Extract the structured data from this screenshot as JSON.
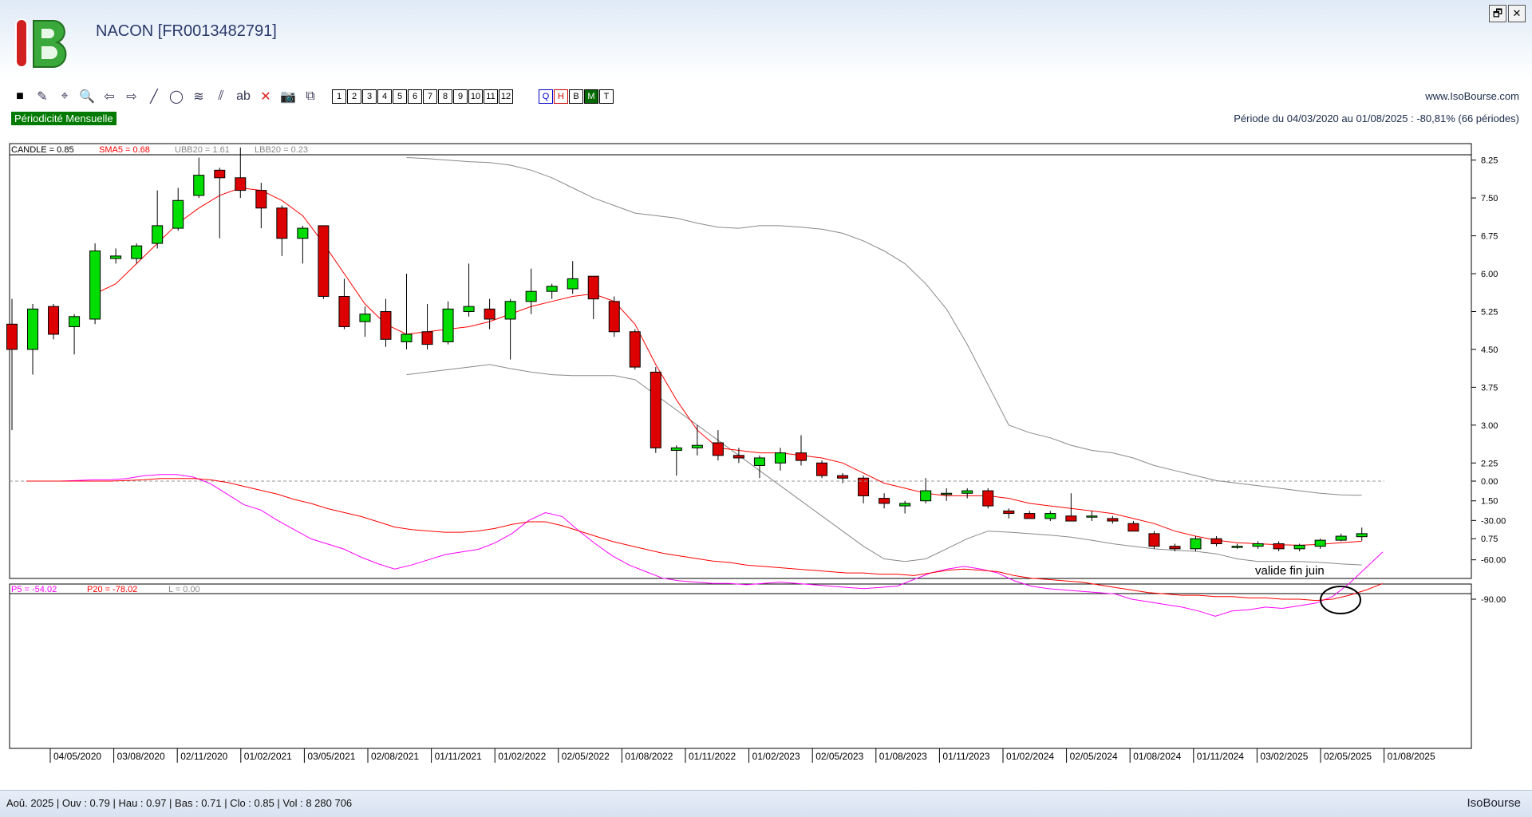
{
  "app": {
    "title": "NACON [FR0013482791]",
    "website": "www.IsoBourse.com",
    "periodicity": "Périodicité Mensuelle",
    "period": "Période du 04/03/2020 au 01/08/2025 : -80,81% (66 périodes)",
    "brand": "IsoBourse"
  },
  "window_buttons": [
    "🗗",
    "✕"
  ],
  "toolbar": {
    "tools": [
      {
        "name": "color-square-icon",
        "glyph": "■"
      },
      {
        "name": "draw-tool-icon",
        "glyph": "✎"
      },
      {
        "name": "crosshair-icon",
        "glyph": "⌖"
      },
      {
        "name": "zoom-icon",
        "glyph": "🔍"
      },
      {
        "name": "arrow-left-icon",
        "glyph": "⇦"
      },
      {
        "name": "arrow-right-icon",
        "glyph": "⇨"
      },
      {
        "name": "line-tool-icon",
        "glyph": "╱"
      },
      {
        "name": "circle-tool-icon",
        "glyph": "◯"
      },
      {
        "name": "fibonacci-icon",
        "glyph": "≋"
      },
      {
        "name": "channel-icon",
        "glyph": "⫽"
      },
      {
        "name": "text-tool-icon",
        "glyph": "ab"
      },
      {
        "name": "delete-icon",
        "glyph": "✕"
      },
      {
        "name": "camera-icon",
        "glyph": "📷"
      },
      {
        "name": "hierarchy-icon",
        "glyph": "⧉"
      }
    ],
    "numbers": [
      "1",
      "2",
      "3",
      "4",
      "5",
      "6",
      "7",
      "8",
      "9",
      "10",
      "11",
      "12"
    ],
    "periods": [
      "Q",
      "H",
      "B",
      "M",
      "T"
    ]
  },
  "colors": {
    "up_candle": "#00dd00",
    "down_candle": "#dd0000",
    "sma": "#ff0000",
    "bands": "#888888",
    "p5": "#ff00ff",
    "p20": "#ff0000"
  },
  "chart_data": [
    {
      "type": "candlestick",
      "legend": [
        {
          "text": "CANDLE = 0.85",
          "color": "#000000"
        },
        {
          "text": "SMA5 = 0.68",
          "color": "#ff0000"
        },
        {
          "text": "UBB20 = 1.61",
          "color": "#888888"
        },
        {
          "text": "LBB20 = 0.23",
          "color": "#888888"
        }
      ],
      "ylim": [
        0.2,
        8.45
      ],
      "yticks": [
        8.25,
        7.5,
        6.75,
        6.0,
        5.25,
        4.5,
        3.75,
        3.0,
        2.25,
        1.5,
        0.75
      ],
      "ytick_labels": [
        "8.25",
        "7.50",
        "6.75",
        "6.00",
        "5.25",
        "4.50",
        "3.75",
        "3.00",
        "2.25",
        "1.50",
        "0.75"
      ],
      "candles": [
        [
          5.0,
          5.5,
          2.9,
          4.5
        ],
        [
          4.5,
          5.4,
          4.0,
          5.3
        ],
        [
          5.35,
          5.4,
          4.7,
          4.8
        ],
        [
          4.95,
          5.2,
          4.4,
          5.15
        ],
        [
          5.1,
          6.6,
          5.0,
          6.45
        ],
        [
          6.3,
          6.5,
          6.2,
          6.35
        ],
        [
          6.3,
          6.6,
          6.2,
          6.55
        ],
        [
          6.6,
          7.65,
          6.5,
          6.95
        ],
        [
          6.9,
          7.7,
          6.85,
          7.45
        ],
        [
          7.55,
          8.3,
          7.5,
          7.95
        ],
        [
          8.05,
          8.1,
          6.7,
          7.9
        ],
        [
          7.9,
          8.5,
          7.5,
          7.65
        ],
        [
          7.65,
          7.8,
          6.9,
          7.3
        ],
        [
          7.3,
          7.35,
          6.35,
          6.7
        ],
        [
          6.7,
          6.95,
          6.2,
          6.9
        ],
        [
          6.95,
          6.95,
          5.5,
          5.55
        ],
        [
          5.55,
          5.9,
          4.9,
          4.95
        ],
        [
          5.05,
          5.35,
          4.75,
          5.2
        ],
        [
          5.25,
          5.5,
          4.55,
          4.7
        ],
        [
          4.65,
          6.0,
          4.5,
          4.8
        ],
        [
          4.85,
          5.4,
          4.5,
          4.6
        ],
        [
          4.65,
          5.45,
          4.6,
          5.3
        ],
        [
          5.25,
          6.2,
          5.15,
          5.35
        ],
        [
          5.3,
          5.5,
          4.9,
          5.1
        ],
        [
          5.1,
          5.5,
          4.3,
          5.45
        ],
        [
          5.45,
          6.1,
          5.2,
          5.65
        ],
        [
          5.65,
          5.8,
          5.5,
          5.75
        ],
        [
          5.7,
          6.25,
          5.6,
          5.9
        ],
        [
          5.95,
          5.95,
          5.1,
          5.5
        ],
        [
          5.45,
          5.55,
          4.75,
          4.85
        ],
        [
          4.85,
          4.9,
          4.1,
          4.15
        ],
        [
          4.05,
          4.15,
          2.45,
          2.55
        ],
        [
          2.5,
          2.6,
          2.0,
          2.55
        ],
        [
          2.55,
          3.0,
          2.4,
          2.6
        ],
        [
          2.65,
          2.9,
          2.3,
          2.4
        ],
        [
          2.4,
          2.55,
          2.25,
          2.35
        ],
        [
          2.2,
          2.4,
          1.95,
          2.35
        ],
        [
          2.25,
          2.55,
          2.1,
          2.45
        ],
        [
          2.45,
          2.8,
          2.2,
          2.3
        ],
        [
          2.25,
          2.3,
          1.95,
          2.0
        ],
        [
          2.0,
          2.05,
          1.85,
          1.95
        ],
        [
          1.95,
          2.0,
          1.45,
          1.6
        ],
        [
          1.55,
          1.65,
          1.35,
          1.45
        ],
        [
          1.4,
          1.5,
          1.25,
          1.45
        ],
        [
          1.5,
          1.95,
          1.45,
          1.7
        ],
        [
          1.65,
          1.75,
          1.5,
          1.65
        ],
        [
          1.65,
          1.75,
          1.55,
          1.7
        ],
        [
          1.7,
          1.75,
          1.35,
          1.4
        ],
        [
          1.3,
          1.35,
          1.15,
          1.25
        ],
        [
          1.25,
          1.3,
          1.15,
          1.15
        ],
        [
          1.15,
          1.3,
          1.1,
          1.25
        ],
        [
          1.2,
          1.65,
          1.15,
          1.1
        ],
        [
          1.2,
          1.3,
          1.1,
          1.2
        ],
        [
          1.15,
          1.2,
          1.05,
          1.1
        ],
        [
          1.05,
          1.1,
          0.9,
          0.9
        ],
        [
          0.85,
          0.9,
          0.55,
          0.6
        ],
        [
          0.6,
          0.65,
          0.5,
          0.55
        ],
        [
          0.55,
          0.8,
          0.5,
          0.75
        ],
        [
          0.75,
          0.8,
          0.6,
          0.65
        ],
        [
          0.6,
          0.65,
          0.55,
          0.6
        ],
        [
          0.6,
          0.7,
          0.55,
          0.65
        ],
        [
          0.65,
          0.7,
          0.5,
          0.55
        ],
        [
          0.55,
          0.65,
          0.5,
          0.62
        ],
        [
          0.6,
          0.75,
          0.55,
          0.72
        ],
        [
          0.72,
          0.85,
          0.7,
          0.8
        ],
        [
          0.79,
          0.97,
          0.71,
          0.85
        ]
      ],
      "sma5": [
        null,
        null,
        null,
        null,
        5.6,
        5.8,
        6.2,
        6.6,
        7.0,
        7.3,
        7.55,
        7.7,
        7.65,
        7.45,
        7.15,
        6.6,
        6.0,
        5.4,
        5.0,
        4.8,
        4.85,
        4.9,
        4.95,
        5.05,
        5.2,
        5.35,
        5.45,
        5.55,
        5.6,
        5.45,
        5.0,
        4.2,
        3.5,
        2.9,
        2.55,
        2.5,
        2.45,
        2.45,
        2.4,
        2.35,
        2.25,
        2.05,
        1.85,
        1.75,
        1.65,
        1.6,
        1.6,
        1.6,
        1.55,
        1.45,
        1.4,
        1.35,
        1.3,
        1.25,
        1.15,
        1.05,
        0.9,
        0.8,
        0.72,
        0.67,
        0.65,
        0.63,
        0.62,
        0.64,
        0.67,
        0.7
      ],
      "ubb20": [
        null,
        null,
        null,
        null,
        null,
        null,
        null,
        null,
        null,
        null,
        null,
        null,
        null,
        null,
        null,
        null,
        null,
        null,
        null,
        8.3,
        8.28,
        8.25,
        8.22,
        8.2,
        8.15,
        8.05,
        7.9,
        7.7,
        7.5,
        7.35,
        7.2,
        7.15,
        7.1,
        7.0,
        6.92,
        6.9,
        6.95,
        6.95,
        6.92,
        6.88,
        6.8,
        6.65,
        6.45,
        6.2,
        5.8,
        5.3,
        4.6,
        3.8,
        3.0,
        2.85,
        2.75,
        2.6,
        2.5,
        2.45,
        2.35,
        2.2,
        2.1,
        2.0,
        1.9,
        1.85,
        1.8,
        1.75,
        1.7,
        1.65,
        1.62,
        1.61
      ],
      "lbb20": [
        null,
        null,
        null,
        null,
        null,
        null,
        null,
        null,
        null,
        null,
        null,
        null,
        null,
        null,
        null,
        null,
        null,
        null,
        null,
        4.0,
        4.05,
        4.1,
        4.15,
        4.2,
        4.12,
        4.05,
        4.0,
        3.98,
        3.98,
        3.98,
        3.9,
        3.6,
        3.3,
        3.0,
        2.7,
        2.4,
        2.1,
        1.8,
        1.5,
        1.2,
        0.9,
        0.6,
        0.35,
        0.3,
        0.35,
        0.55,
        0.75,
        0.9,
        0.88,
        0.85,
        0.82,
        0.78,
        0.72,
        0.65,
        0.6,
        0.55,
        0.52,
        0.5,
        0.45,
        0.35,
        0.3,
        0.3,
        0.3,
        0.28,
        0.25,
        0.23
      ]
    },
    {
      "type": "line",
      "legend": [
        {
          "text": "P5 = -54.02",
          "color": "#ff00ff"
        },
        {
          "text": "P20 = -78.02",
          "color": "#ff0000"
        },
        {
          "text": "L = 0.00",
          "color": "#888888"
        }
      ],
      "ylim": [
        -105,
        6
      ],
      "yticks": [
        0,
        -30,
        -60,
        -90
      ],
      "ytick_labels": [
        "0.00",
        "-30.00",
        "-60.00",
        "-90.00"
      ],
      "zero_line": 0,
      "series": [
        {
          "name": "P5",
          "values": [
            null,
            0,
            0,
            0,
            0.5,
            1,
            1,
            2,
            4,
            5,
            5,
            3,
            -2,
            -10,
            -18,
            -22,
            -30,
            -37,
            -44,
            -48,
            -52,
            -58,
            -63,
            -67,
            -64,
            -60,
            -56,
            -54,
            -52,
            -47,
            -40,
            -30,
            -24,
            -27,
            -38,
            -48,
            -57,
            -64,
            -69,
            -74,
            -76,
            -77,
            -78,
            -78,
            -79,
            -78,
            -77,
            -78,
            -79,
            -80,
            -81,
            -82,
            -81,
            -80,
            -75,
            -70,
            -67,
            -65,
            -67,
            -70,
            -76,
            -80,
            -82,
            -83,
            -84,
            -85,
            -86,
            -90,
            -92,
            -94,
            -96,
            -99,
            -103,
            -99,
            -98,
            -96,
            -97,
            -95,
            -93,
            -88,
            -78,
            -66,
            -54
          ]
        },
        {
          "name": "P20",
          "values": [
            null,
            0,
            0,
            0,
            0,
            0,
            0,
            0.5,
            1,
            2,
            2,
            2,
            1,
            -1,
            -4,
            -7,
            -10,
            -14,
            -17,
            -21,
            -24,
            -27,
            -31,
            -35,
            -37,
            -38,
            -39,
            -39,
            -38,
            -36,
            -33,
            -31,
            -31,
            -34,
            -38,
            -42,
            -46,
            -49,
            -52,
            -55,
            -57,
            -59,
            -61,
            -62,
            -64,
            -65,
            -66,
            -67,
            -68,
            -69,
            -70,
            -70,
            -71,
            -71,
            -72,
            -70,
            -68,
            -67,
            -68,
            -69,
            -72,
            -74,
            -75,
            -76,
            -77,
            -79,
            -81,
            -83,
            -85,
            -86,
            -87,
            -87,
            -88,
            -88,
            -89,
            -89,
            -90,
            -90,
            -91,
            -90,
            -87,
            -83,
            -78
          ]
        }
      ],
      "annotation": "valide fin juin"
    }
  ],
  "x_axis": {
    "labels": [
      "04/05/2020",
      "03/08/2020",
      "02/11/2020",
      "01/02/2021",
      "03/05/2021",
      "02/08/2021",
      "01/11/2021",
      "01/02/2022",
      "02/05/2022",
      "01/08/2022",
      "01/11/2022",
      "01/02/2023",
      "02/05/2023",
      "01/08/2023",
      "01/11/2023",
      "01/02/2024",
      "02/05/2024",
      "01/08/2024",
      "01/11/2024",
      "03/02/2025",
      "02/05/2025",
      "01/08/2025"
    ]
  },
  "statusbar": {
    "info": "Aoû. 2025 | Ouv : 0.79 | Hau : 0.97 | Bas : 0.71 | Clo : 0.85 | Vol : 8 280 706"
  }
}
